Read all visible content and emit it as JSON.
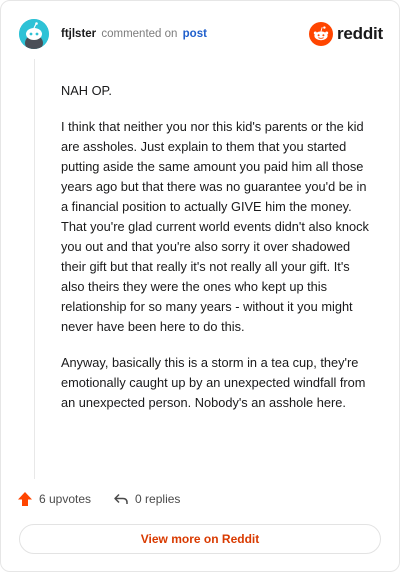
{
  "header": {
    "username": "ftjlster",
    "action": "commented on",
    "post_link": "post",
    "brand": "reddit"
  },
  "comment": {
    "paragraphs": [
      "NAH OP.",
      "I think that neither you nor this kid's parents or the kid are assholes. Just explain to them that you started putting aside the same amount you paid him all those years ago but that there was no guarantee you'd be in a financial position to actually GIVE him the money. That you're glad current world events didn't also knock you out and that you're also sorry it over shadowed their gift but that really it's not really all your gift. It's also theirs they were the ones who kept up this relationship for so many years - without it you might never have been here to do this.",
      "Anyway, basically this is a storm in a tea cup, they're emotionally caught up by an unexpected windfall from an unexpected person. Nobody's an asshole here."
    ]
  },
  "actions": {
    "upvotes": "6 upvotes",
    "replies": "0 replies"
  },
  "footer": {
    "view_more": "View more on Reddit"
  },
  "colors": {
    "brand_orange": "#ff4500",
    "link_blue": "#1f5fcc",
    "cta_text": "#d93a00",
    "avatar_bg": "#2ec2d6"
  },
  "icons": {
    "avatar": "snoo-avatar-icon",
    "brand": "reddit-logo-icon",
    "upvote": "upvote-arrow-icon",
    "reply": "reply-arrow-icon"
  }
}
